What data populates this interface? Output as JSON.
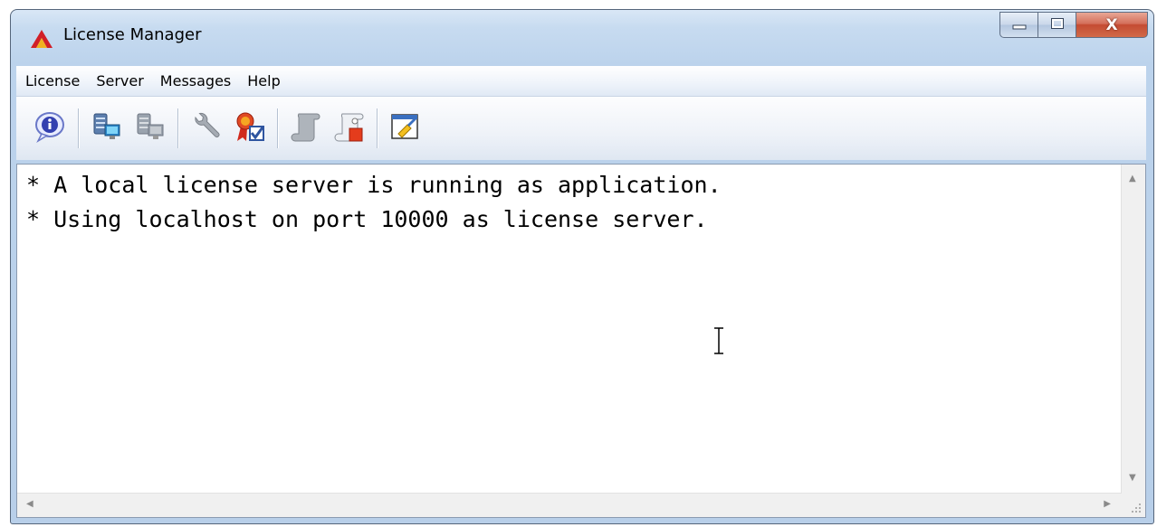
{
  "window": {
    "title": "License Manager",
    "icon": "license-manager-app-icon"
  },
  "caption_buttons": {
    "minimize_icon": "minimize-icon",
    "maximize_icon": "maximize-icon",
    "close_label": "X"
  },
  "menu": {
    "items": [
      {
        "label": "License"
      },
      {
        "label": "Server"
      },
      {
        "label": "Messages"
      },
      {
        "label": "Help"
      }
    ]
  },
  "toolbar": {
    "buttons": [
      {
        "icon": "info-icon"
      },
      {
        "icon": "connect-server-icon"
      },
      {
        "icon": "disconnect-server-icon"
      },
      {
        "icon": "wrench-icon"
      },
      {
        "icon": "license-certificate-icon"
      },
      {
        "icon": "script-icon"
      },
      {
        "icon": "script-stop-icon"
      },
      {
        "icon": "clear-log-icon"
      }
    ]
  },
  "log": {
    "lines": [
      "* A local license server is running as application.",
      "* Using localhost on port 10000 as license server."
    ]
  },
  "colors": {
    "window_frame": "#b8cfe9",
    "close_button": "#c44b32",
    "content_bg": "#ffffff"
  }
}
